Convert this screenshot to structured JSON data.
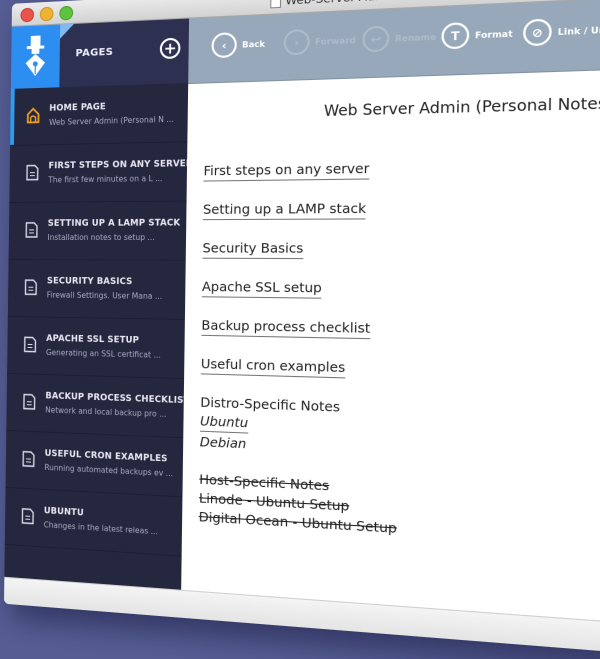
{
  "window": {
    "title": "Web-Server-Admin-Notes.scribbleton"
  },
  "sidebar": {
    "header_label": "PAGES",
    "add_label": "+",
    "items": [
      {
        "title": "HOME PAGE",
        "subtitle": "Web Server Admin (Personal N ...",
        "icon": "home-icon",
        "active": true
      },
      {
        "title": "FIRST STEPS ON ANY SERVER",
        "subtitle": "The first few minutes on a L ...",
        "icon": "document-icon"
      },
      {
        "title": "SETTING UP A LAMP STACK",
        "subtitle": "Installation notes to setup ...",
        "icon": "document-icon"
      },
      {
        "title": "SECURITY BASICS",
        "subtitle": "Firewall Settings. User Mana ...",
        "icon": "document-icon"
      },
      {
        "title": "APACHE SSL SETUP",
        "subtitle": "Generating an SSL certificat ...",
        "icon": "document-icon"
      },
      {
        "title": "BACKUP PROCESS CHECKLIST",
        "subtitle": "Network and local backup pro ...",
        "icon": "document-icon"
      },
      {
        "title": "USEFUL CRON EXAMPLES",
        "subtitle": "Running automated backups ev ...",
        "icon": "document-icon"
      },
      {
        "title": "UBUNTU",
        "subtitle": "Changes in the latest releas ...",
        "icon": "document-icon"
      }
    ]
  },
  "toolbar": {
    "back": "Back",
    "forward": "Forward",
    "rename": "Rename",
    "format": "Format",
    "link": "Link / Unlink"
  },
  "content": {
    "title": "Web Server Admin (Personal Notes)",
    "links": [
      "First steps on any server",
      "Setting up a LAMP stack",
      "Security Basics",
      "Apache SSL setup",
      "Backup process checklist",
      "Useful cron examples"
    ],
    "distro_heading": "Distro-Specific Notes",
    "distro_items": [
      "Ubuntu",
      "Debian"
    ],
    "host_heading": "Host-Specific Notes",
    "host_items": [
      "Linode - Ubuntu Setup",
      "Digital Ocean - Ubuntu Setup"
    ]
  },
  "colors": {
    "background": "#555d93",
    "sidebar": "#25273f",
    "accent": "#2b8ef0",
    "toolbar": "#97a8ba",
    "home_icon": "#f0a020"
  }
}
